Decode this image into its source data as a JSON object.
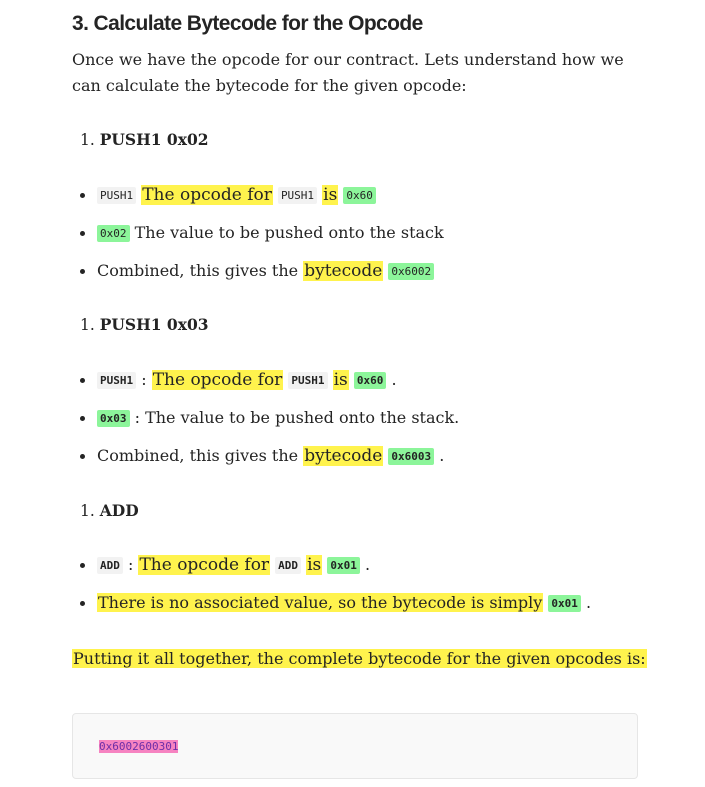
{
  "heading": "3. Calculate Bytecode for the Opcode",
  "intro": "Once we have the opcode for our contract. Lets understand how we can calculate the bytecode for the given opcode:",
  "step1": {
    "num": "1.",
    "title": "PUSH1 0x02",
    "b1": {
      "code": "PUSH1",
      "text_a": "The opcode for",
      "code2": "PUSH1",
      "text_b": "is",
      "code3": "0x60"
    },
    "b2": {
      "code": "0x02",
      "text": " The value to be pushed onto the stack"
    },
    "b3": {
      "text": "Combined, this gives the ",
      "hl": "bytecode",
      "code": "0x6002"
    }
  },
  "step2": {
    "num": "1.",
    "title": "PUSH1 0x03",
    "b1": {
      "code": "PUSH1",
      "sep": " : ",
      "text_a": "The opcode for",
      "code2": "PUSH1",
      "text_b": "is",
      "code3": "0x60",
      "end": " ."
    },
    "b2": {
      "code": "0x03",
      "text": " : The value to be pushed onto the stack."
    },
    "b3": {
      "text": "Combined, this gives the ",
      "hl": "bytecode",
      "code": "0x6003",
      "end": " ."
    }
  },
  "step3": {
    "num": "1.",
    "title": "ADD",
    "b1": {
      "code": "ADD",
      "sep": " : ",
      "text_a": "The opcode for",
      "code2": "ADD",
      "text_b": "is",
      "code3": "0x01",
      "end": " ."
    },
    "b2": {
      "text": "There is no associated value, so the bytecode is simply",
      "code": "0x01",
      "end": " ."
    }
  },
  "summary": "Putting it all together, the complete bytecode for the given opcodes is:",
  "code_block": "0x6002600301",
  "colors": {
    "highlight": "#fff34d",
    "code_green": "#8cf59a",
    "code_pink": "#f683c1",
    "text": "#242424"
  }
}
